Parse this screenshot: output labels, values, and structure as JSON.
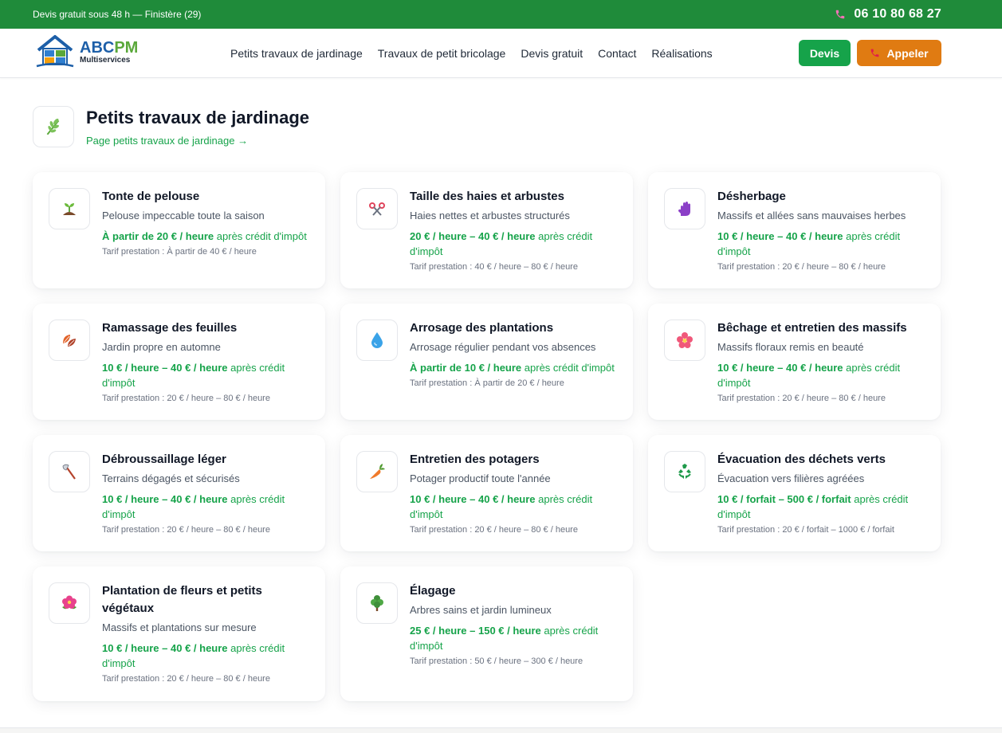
{
  "topbar": {
    "tagline": "Devis gratuit sous 48 h — Finistère (29)",
    "phone": "06 10 80 68 27"
  },
  "brand": {
    "name_part1": "ABC",
    "name_part2": "PM",
    "subtitle": "Multiservices"
  },
  "nav": {
    "items": [
      "Petits travaux de jardinage",
      "Travaux de petit bricolage",
      "Devis gratuit",
      "Contact",
      "Réalisations"
    ]
  },
  "buttons": {
    "devis": "Devis",
    "call": "Appeler"
  },
  "section": {
    "title": "Petits travaux de jardinage",
    "link": "Page petits travaux de jardinage →"
  },
  "colors": {
    "topbar": "#1f8b3a",
    "accent_green": "#16a34a",
    "call_orange": "#e07b12"
  },
  "services": [
    {
      "icon": "seedling-icon",
      "title": "Tonte de pelouse",
      "desc": "Pelouse impeccable toute la saison",
      "price": "À partir de 20 € / heure",
      "suffix": " après crédit d'impôt",
      "tarif": "Tarif prestation : À partir de 40 € / heure"
    },
    {
      "icon": "scissors-icon",
      "title": "Taille des haies et arbustes",
      "desc": "Haies nettes et arbustes structurés",
      "price": "20 € / heure – 40 € / heure",
      "suffix": " après crédit d'impôt",
      "tarif": "Tarif prestation : 40 € / heure – 80 € / heure"
    },
    {
      "icon": "glove-icon",
      "title": "Désherbage",
      "desc": "Massifs et allées sans mauvaises herbes",
      "price": "10 € / heure – 40 € / heure",
      "suffix": " après crédit d'impôt",
      "tarif": "Tarif prestation : 20 € / heure – 80 € / heure"
    },
    {
      "icon": "leaves-icon",
      "title": "Ramassage des feuilles",
      "desc": "Jardin propre en automne",
      "price": "10 € / heure – 40 € / heure",
      "suffix": " après crédit d'impôt",
      "tarif": "Tarif prestation : 20 € / heure – 80 € / heure"
    },
    {
      "icon": "water-drop-icon",
      "title": "Arrosage des plantations",
      "desc": "Arrosage régulier pendant vos absences",
      "price": "À partir de 10 € / heure",
      "suffix": " après crédit d'impôt",
      "tarif": "Tarif prestation : À partir de 20 € / heure"
    },
    {
      "icon": "flower-icon",
      "title": "Bêchage et entretien des massifs",
      "desc": "Massifs floraux remis en beauté",
      "price": "10 € / heure – 40 € / heure",
      "suffix": " après crédit d'impôt",
      "tarif": "Tarif prestation : 20 € / heure – 80 € / heure"
    },
    {
      "icon": "axe-icon",
      "title": "Débroussaillage léger",
      "desc": "Terrains dégagés et sécurisés",
      "price": "10 € / heure – 40 € / heure",
      "suffix": " après crédit d'impôt",
      "tarif": "Tarif prestation : 20 € / heure – 80 € / heure"
    },
    {
      "icon": "carrot-icon",
      "title": "Entretien des potagers",
      "desc": "Potager productif toute l'année",
      "price": "10 € / heure – 40 € / heure",
      "suffix": " après crédit d'impôt",
      "tarif": "Tarif prestation : 20 € / heure – 80 € / heure"
    },
    {
      "icon": "recycle-icon",
      "title": "Évacuation des déchets verts",
      "desc": "Évacuation vers filières agréées",
      "price": "10 € / forfait – 500 € / forfait",
      "suffix": " après crédit d'impôt",
      "tarif": "Tarif prestation : 20 € / forfait – 1000 € / forfait"
    },
    {
      "icon": "hibiscus-icon",
      "title": "Plantation de fleurs et petits végétaux",
      "desc": "Massifs et plantations sur mesure",
      "price": "10 € / heure – 40 € / heure",
      "suffix": " après crédit d'impôt",
      "tarif": "Tarif prestation : 20 € / heure – 80 € / heure"
    },
    {
      "icon": "tree-icon",
      "title": "Élagage",
      "desc": "Arbres sains et jardin lumineux",
      "price": "25 € / heure – 150 € / heure",
      "suffix": " après crédit d'impôt",
      "tarif": "Tarif prestation : 50 € / heure – 300 € / heure"
    }
  ]
}
